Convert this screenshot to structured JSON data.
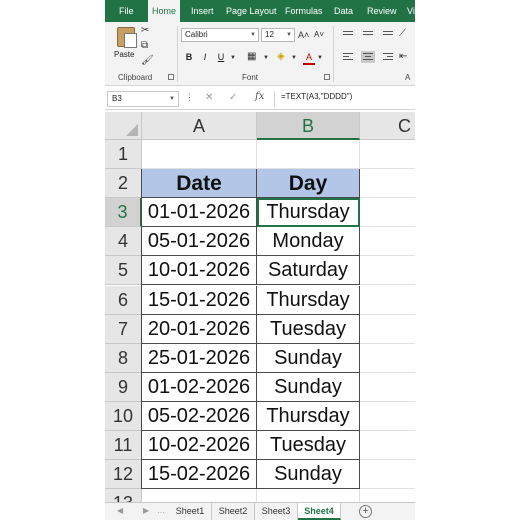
{
  "ribbon": {
    "tabs": [
      "File",
      "Home",
      "Insert",
      "Page Layout",
      "Formulas",
      "Data",
      "Review",
      "Vi"
    ],
    "active_tab": "Home",
    "clipboard": {
      "paste_label": "Paste",
      "group_label": "Clipboard"
    },
    "font": {
      "font_name": "Calibri",
      "font_size": "12",
      "group_label": "Font",
      "bold": "B",
      "italic": "I",
      "underline": "U",
      "font_color_glyph": "A"
    },
    "alignment": {
      "group_label": "A"
    }
  },
  "formula_bar": {
    "name_box": "B3",
    "fx": "fx",
    "formula": "=TEXT(A3,\"DDDD\")"
  },
  "grid": {
    "columns": [
      "A",
      "B",
      "C"
    ],
    "selected_column": "B",
    "rows": [
      "1",
      "2",
      "3",
      "4",
      "5",
      "6",
      "7",
      "8",
      "9",
      "10",
      "11",
      "12",
      "13"
    ],
    "selected_row": "3",
    "active_cell": "B3",
    "table": {
      "header_fill": "#b4c6e7",
      "headers": [
        "Date",
        "Day"
      ],
      "data": [
        [
          "01-01-2026",
          "Thursday"
        ],
        [
          "05-01-2026",
          "Monday"
        ],
        [
          "10-01-2026",
          "Saturday"
        ],
        [
          "15-01-2026",
          "Thursday"
        ],
        [
          "20-01-2026",
          "Tuesday"
        ],
        [
          "25-01-2026",
          "Sunday"
        ],
        [
          "01-02-2026",
          "Sunday"
        ],
        [
          "05-02-2026",
          "Thursday"
        ],
        [
          "10-02-2026",
          "Tuesday"
        ],
        [
          "15-02-2026",
          "Sunday"
        ]
      ]
    }
  },
  "sheets": {
    "tabs": [
      "Sheet1",
      "Sheet2",
      "Sheet3",
      "Sheet4"
    ],
    "active": "Sheet4",
    "add_glyph": "+"
  },
  "colors": {
    "accent": "#217346"
  }
}
